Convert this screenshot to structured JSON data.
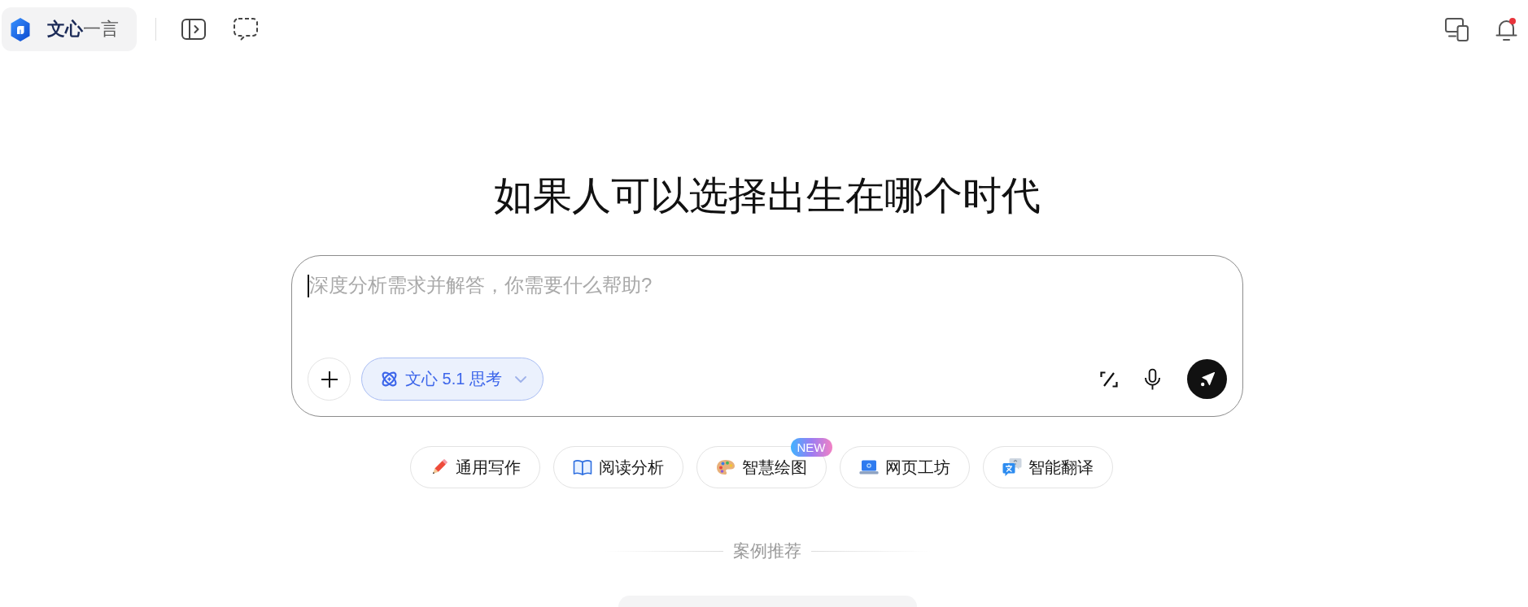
{
  "header": {
    "logo": {
      "text": "**文心**一言"
    },
    "notifications": {
      "unread": true
    }
  },
  "title": "如果人可以选择出生在哪个时代",
  "composer": {
    "placeholder": "深度分析需求并解答，你需要什么帮助?",
    "focused": true,
    "model": {
      "label": "文心 5.1 思考"
    }
  },
  "shortcuts": [
    {
      "label": "通用写作"
    },
    {
      "label": "阅读分析"
    },
    {
      "label": "智慧绘图",
      "badge": "NEW"
    },
    {
      "label": "网页工坊"
    },
    {
      "label": "智能翻译"
    }
  ],
  "examples": {
    "heading": "案例推荐"
  }
}
